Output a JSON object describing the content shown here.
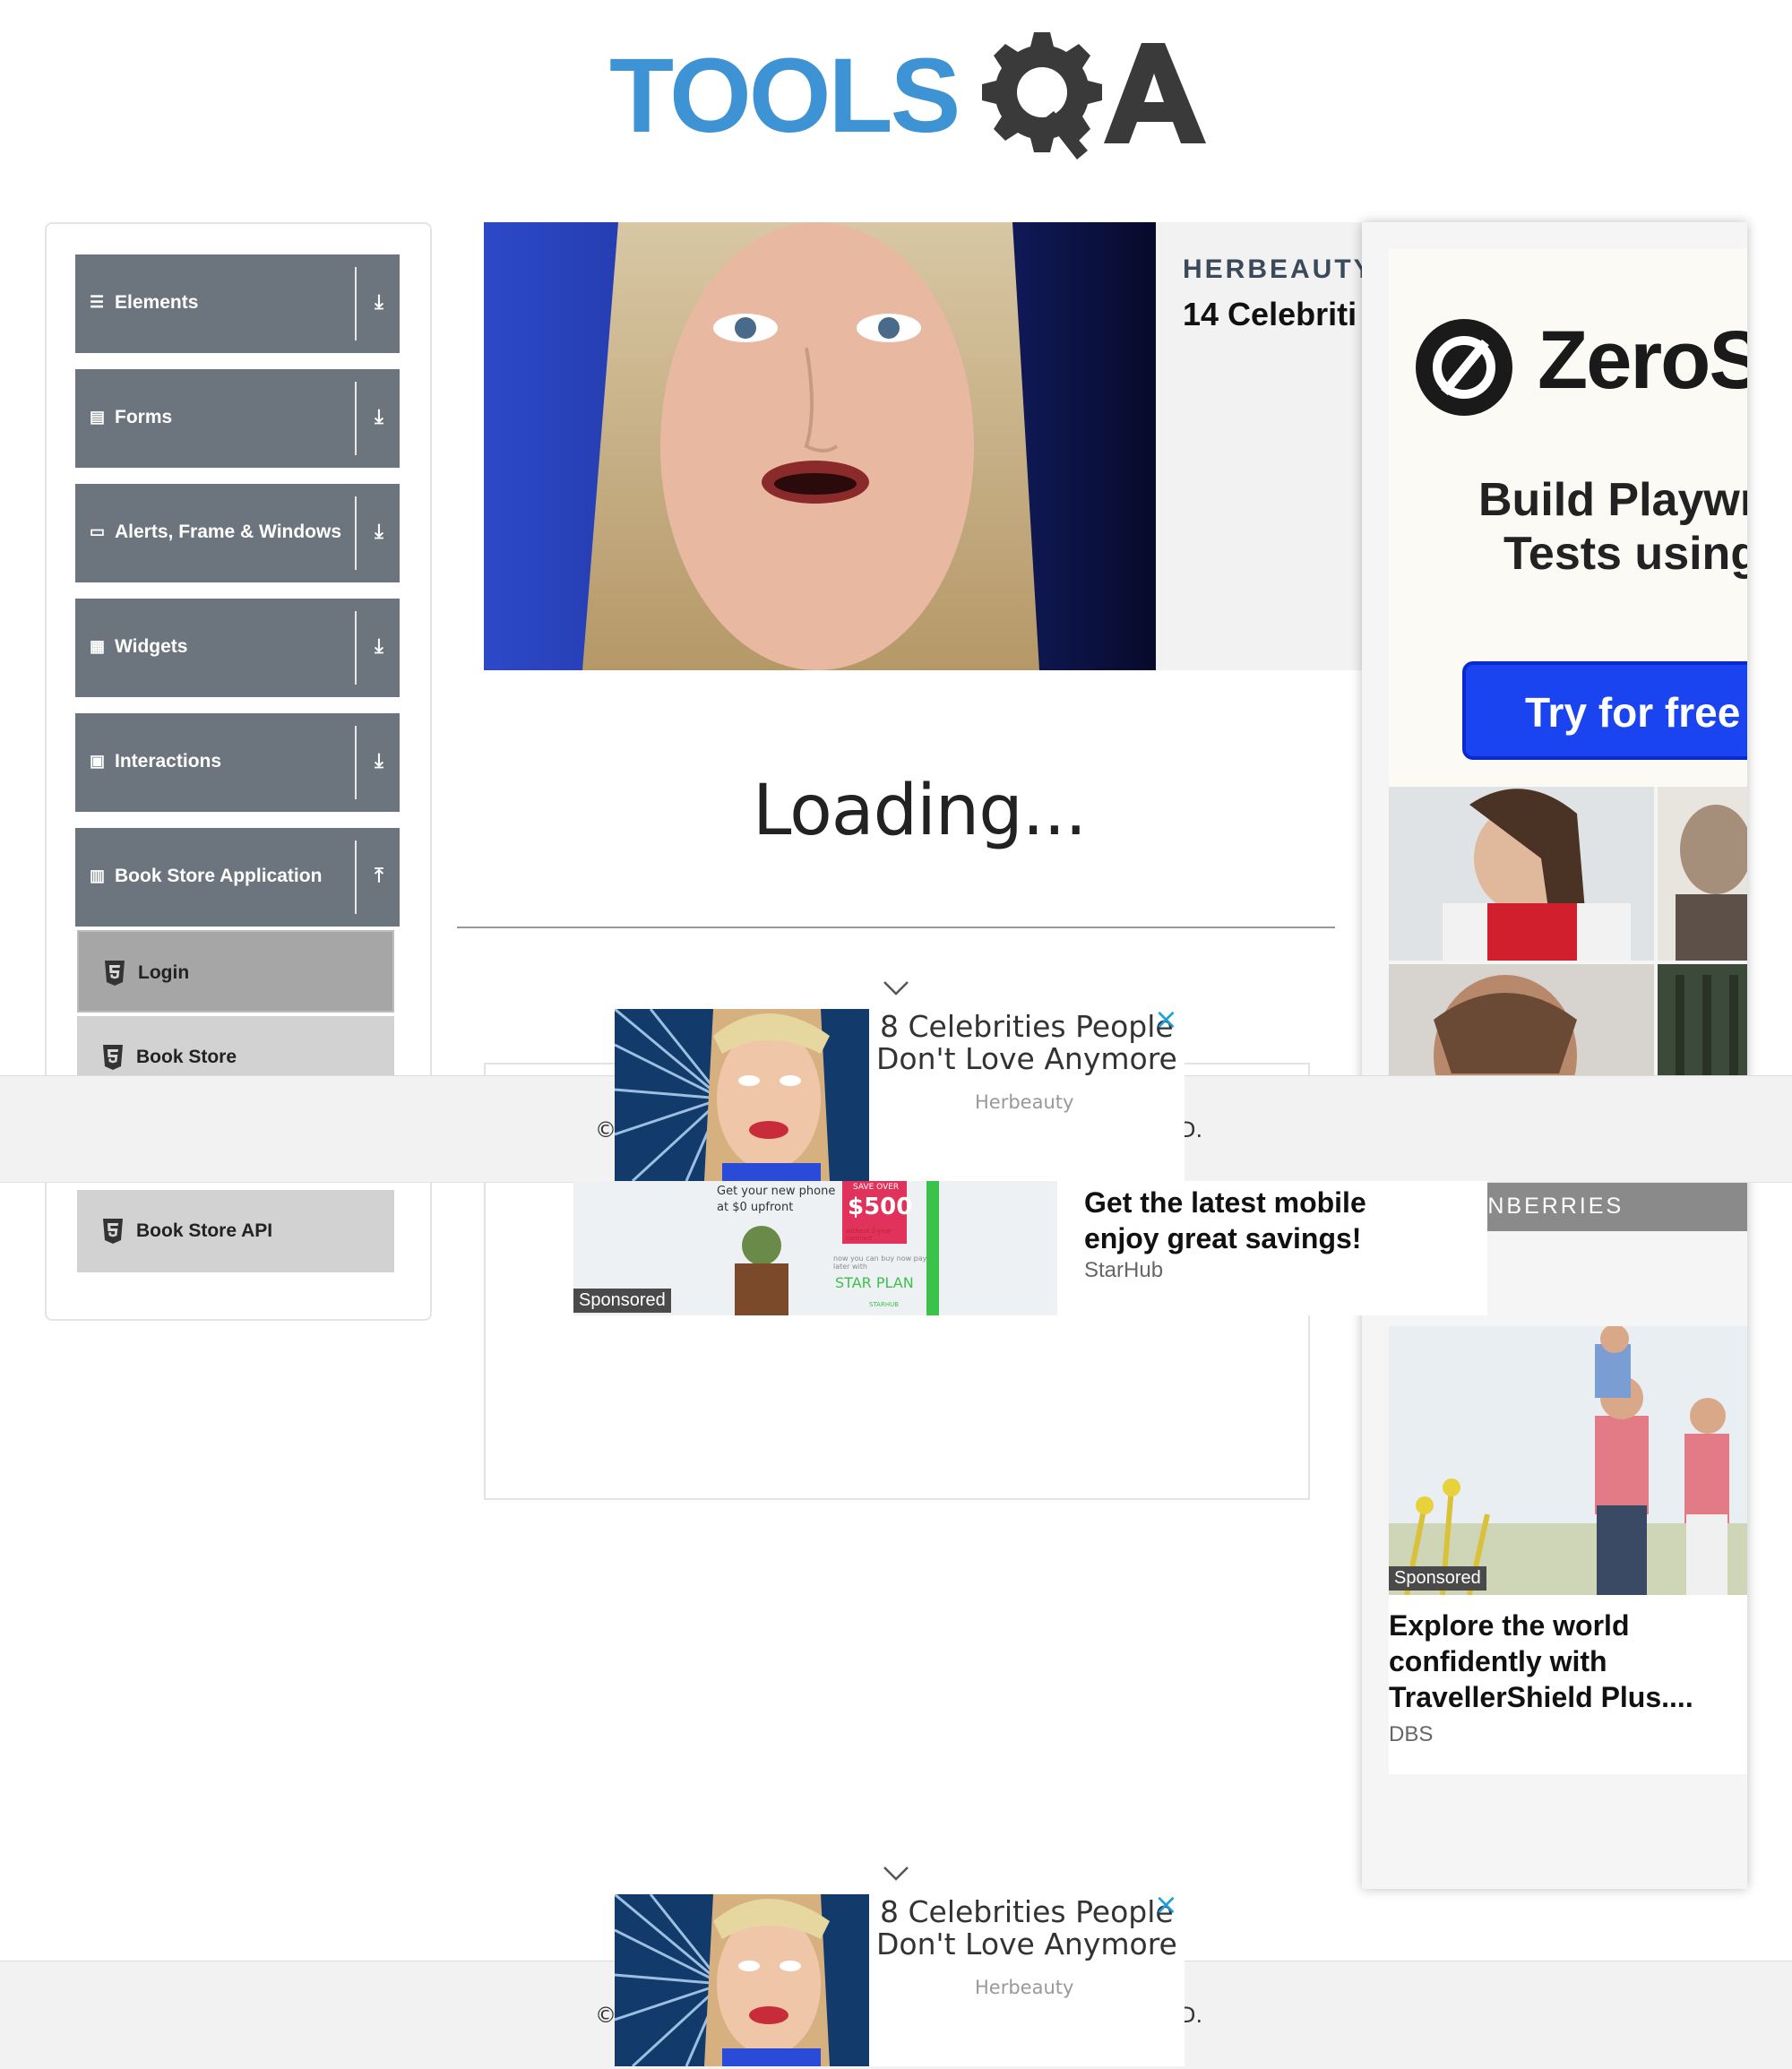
{
  "logo": {
    "text": "TOOLS",
    "suffix": "A"
  },
  "sidebar": {
    "groups": [
      {
        "label": "Elements",
        "icon": "list-icon",
        "arrow": "⤓"
      },
      {
        "label": "Forms",
        "icon": "form-icon",
        "arrow": "⤓"
      },
      {
        "label": "Alerts, Frame & Windows",
        "icon": "window-icon",
        "arrow": "⤓"
      },
      {
        "label": "Widgets",
        "icon": "widgets-icon",
        "arrow": "⤓"
      },
      {
        "label": "Interactions",
        "icon": "interactions-icon",
        "arrow": "⤓"
      },
      {
        "label": "Book Store Application",
        "icon": "library-icon",
        "arrow": "⤒"
      }
    ],
    "subitems": [
      {
        "label": "Login",
        "icon": "html5-icon",
        "active": true
      },
      {
        "label": "Book Store",
        "icon": "html5-icon"
      },
      {
        "label": "Book Store API",
        "icon": "html5-icon"
      }
    ]
  },
  "main": {
    "loading": "Loading..."
  },
  "ads": {
    "top_banner": {
      "brand": "HERBEAUTY",
      "headline": "14 Celebriti"
    },
    "zerostep": {
      "name": "ZeroSte",
      "tagline_1": "Build Playwrig",
      "tagline_2": "Tests using A",
      "cta": "Try for free →"
    },
    "brainberries": {
      "label": "BRAINBERRIES"
    },
    "dbs": {
      "sponsored": "Sponsored",
      "title": "Explore the world confidently with TravellerShield Plus....",
      "source": "DBS"
    },
    "herbeauty_mini": {
      "title_line1": "8 Celebrities People",
      "title_line2": "Don't Love Anymore",
      "source": "Herbeauty",
      "close": "×"
    },
    "starhub": {
      "sponsored": "Sponsored",
      "title_line1": "Get the latest mobile",
      "title_line2": "enjoy great savings!",
      "source": "StarHub",
      "img_text_1": "Get your new phone",
      "img_text_2": "at $0 upfront",
      "img_badge_top": "SAVE OVER",
      "img_badge": "$500",
      "img_badge_bottom": "without 2-year contract",
      "img_plan_1": "now you can buy now pay later with",
      "img_plan_2": "STAR PLAN",
      "img_brand": "STARHUB"
    }
  },
  "footer": {
    "partial_left": "©",
    "partial_right": "D."
  },
  "colors": {
    "sidebar_group": "#6c757d",
    "logo_blue": "#3d93d3",
    "logo_gray": "#3a3a3a",
    "cta_blue": "#1a44f0",
    "close_blue": "#1ea0d8"
  }
}
